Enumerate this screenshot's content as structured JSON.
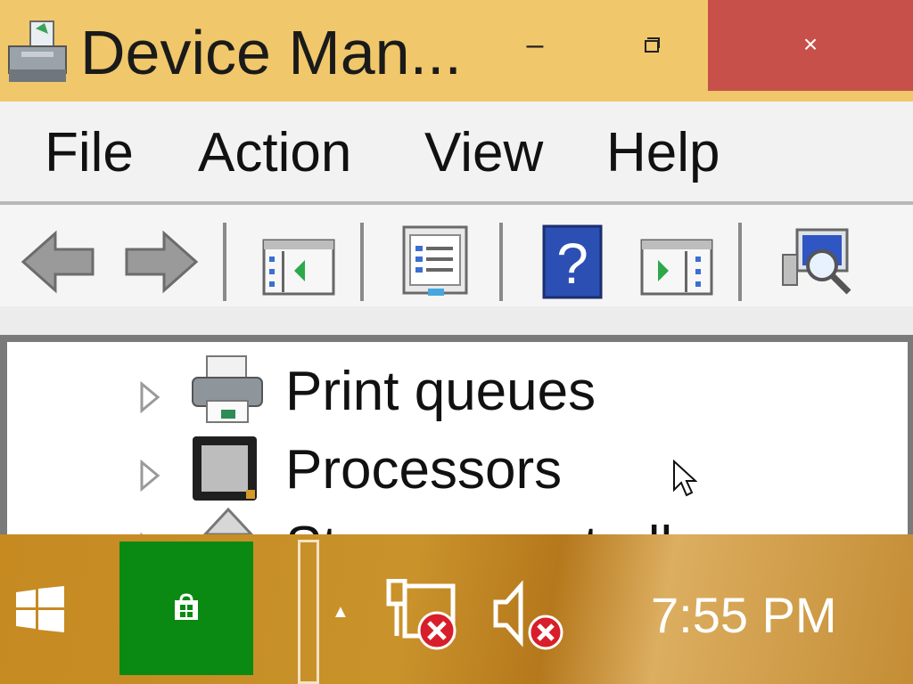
{
  "window": {
    "title": "Device Man...",
    "controls": {
      "minimize": "–",
      "close": "×"
    }
  },
  "menu": {
    "items": [
      "File",
      "Action",
      "View",
      "Help"
    ]
  },
  "toolbar": {
    "buttons": [
      "back-arrow-icon",
      "forward-arrow-icon",
      "show-hide-console-tree-icon",
      "properties-icon",
      "help-icon",
      "show-action-pane-icon",
      "scan-hardware-icon"
    ]
  },
  "tree": {
    "items": [
      {
        "label": "Print queues",
        "icon": "printer-icon"
      },
      {
        "label": "Processors",
        "icon": "processor-icon"
      },
      {
        "label": "Storage controllers",
        "icon": "storage-icon"
      }
    ]
  },
  "taskbar": {
    "clock": "7:55 PM",
    "tray": [
      "network-disconnected-icon",
      "volume-muted-icon"
    ],
    "tray_overflow": "▲"
  },
  "colors": {
    "titlebar": "#f0c76a",
    "close": "#c7504a",
    "store_tile": "#0a8a12"
  }
}
